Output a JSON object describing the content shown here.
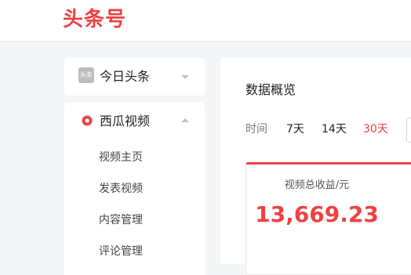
{
  "header": {
    "logo": "头条号"
  },
  "sidebar": {
    "toutiao": {
      "icon": "toutiao-icon",
      "icon_text": "头条",
      "label": "今日头条"
    },
    "xigua": {
      "icon": "xigua-video-icon",
      "label": "西瓜视频",
      "items": [
        {
          "label": "视频主页"
        },
        {
          "label": "发表视频"
        },
        {
          "label": "内容管理"
        },
        {
          "label": "评论管理"
        }
      ]
    }
  },
  "main": {
    "title": "数据概览",
    "time_label": "时间",
    "tabs": [
      {
        "label": "7天",
        "active": false
      },
      {
        "label": "14天",
        "active": false
      },
      {
        "label": "30天",
        "active": true
      }
    ],
    "stat": {
      "label": "视频总收益/元",
      "value": "13,669.23"
    }
  },
  "colors": {
    "brand": "#f04142",
    "background": "#f4f5f6"
  }
}
